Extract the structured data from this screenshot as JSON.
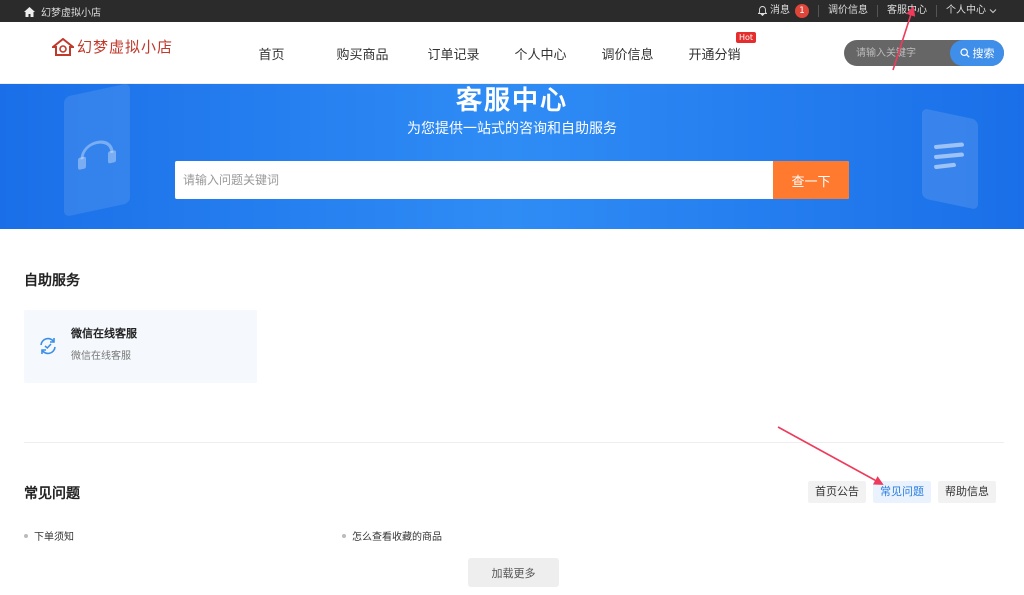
{
  "topbar": {
    "shop_name": "幻梦虚拟小店",
    "messages_label": "消息",
    "messages_count": "1",
    "price_info": "调价信息",
    "service_center": "客服中心",
    "personal_center": "个人中心"
  },
  "header": {
    "logo_text": "幻梦虚拟小店",
    "nav": [
      {
        "label": "首页"
      },
      {
        "label": "购买商品"
      },
      {
        "label": "订单记录"
      },
      {
        "label": "个人中心"
      },
      {
        "label": "调价信息"
      },
      {
        "label": "开通分销",
        "badge": "Hot"
      }
    ],
    "search_placeholder": "请输入关键字",
    "search_button": "搜索"
  },
  "banner": {
    "title": "客服中心",
    "subtitle": "为您提供一站式的咨询和自助服务",
    "search_placeholder": "请输入问题关键词",
    "search_button": "查一下"
  },
  "self_service": {
    "title": "自助服务",
    "card": {
      "name": "微信在线客服",
      "desc": "微信在线客服"
    }
  },
  "faq": {
    "title": "常见问题",
    "tabs": [
      {
        "label": "首页公告",
        "active": false
      },
      {
        "label": "常见问题",
        "active": true
      },
      {
        "label": "帮助信息",
        "active": false
      }
    ],
    "items": [
      {
        "label": "下单须知"
      },
      {
        "label": "怎么查看收藏的商品"
      }
    ],
    "load_more": "加载更多"
  },
  "colors": {
    "accent": "#2a7de1",
    "banner": "#1f7af0",
    "search_button": "#ff7a2f",
    "annotation": "#ee3b5b"
  }
}
